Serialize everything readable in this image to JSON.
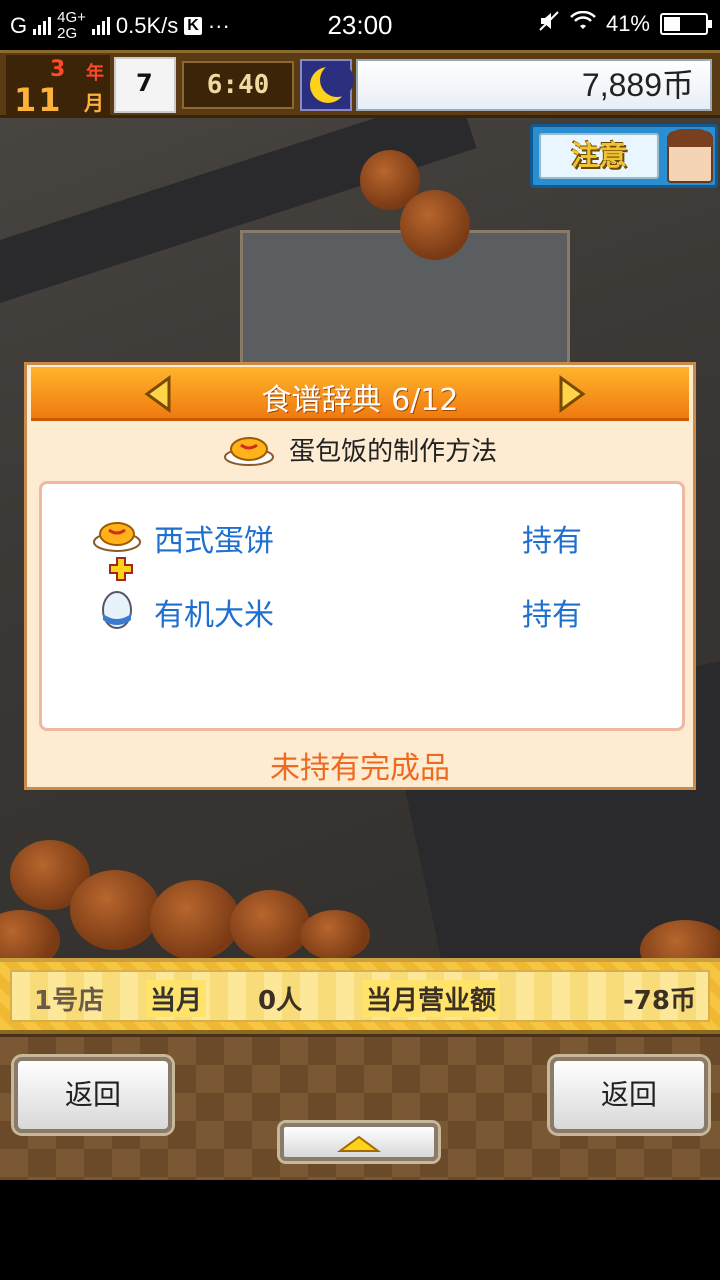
{
  "status_bar": {
    "carrier_left": "G",
    "network_top": "4G+",
    "network_bottom": "2G",
    "speed": "0.5K/s",
    "k_badge": "K",
    "dots": "···",
    "time": "23:00",
    "battery": "41%"
  },
  "hud": {
    "year_num": "3",
    "year_label": "年",
    "month_num": "11",
    "month_label": "月",
    "clock_day": "7",
    "game_time": "6:40",
    "money": "7,889币"
  },
  "attention": {
    "label": "注意"
  },
  "dialog": {
    "title": "食谱辞典 6/12",
    "recipe_title": "蛋包饭的制作方法",
    "ingredients": [
      {
        "name": "西式蛋饼",
        "status": "持有",
        "icon": "omelette-icon"
      },
      {
        "name": "有机大米",
        "status": "持有",
        "icon": "rice-icon"
      }
    ],
    "footer": "未持有完成品"
  },
  "infobar": {
    "store": "1号店",
    "month_label": "当月",
    "customers": "0人",
    "revenue_label": "当月营业额",
    "revenue_value": "-78币"
  },
  "buttons": {
    "back_left": "返回",
    "back_right": "返回"
  },
  "colors": {
    "header_orange": "#f07a10",
    "link_blue": "#1f6fcf",
    "footer_orange": "#ee6a20"
  }
}
